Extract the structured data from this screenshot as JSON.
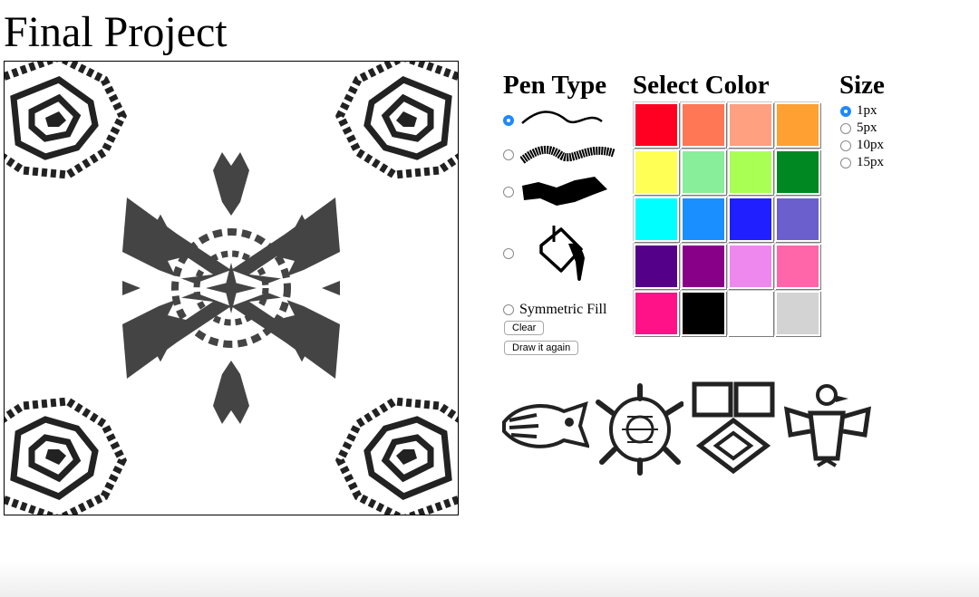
{
  "page": {
    "title": "Final Project"
  },
  "canvas": {
    "description_icon": "mandala-drawing"
  },
  "pen_type": {
    "title": "Pen Type",
    "options": [
      {
        "icon": "thin-wave-pen-icon",
        "selected": true
      },
      {
        "icon": "rough-pen-icon",
        "selected": false
      },
      {
        "icon": "thick-brush-pen-icon",
        "selected": false
      },
      {
        "icon": "paint-bucket-icon",
        "selected": false
      }
    ],
    "symmetric_fill_label": "Symmetric Fill",
    "clear_label": "Clear",
    "draw_again_label": "Draw it again"
  },
  "select_color": {
    "title": "Select Color",
    "colors": [
      "#ff0022",
      "#ff7755",
      "#ffa080",
      "#ffa033",
      "#ffff55",
      "#88ee99",
      "#aaff55",
      "#008822",
      "#00ffff",
      "#1a8fff",
      "#1f1fff",
      "#6a5fcc",
      "#550088",
      "#880088",
      "#ee88ee",
      "#ff66aa",
      "#ff1188",
      "#000000",
      "#ffffff",
      "#d3d3d3"
    ]
  },
  "size": {
    "title": "Size",
    "options": [
      {
        "label": "1px",
        "selected": true
      },
      {
        "label": "5px",
        "selected": false
      },
      {
        "label": "10px",
        "selected": false
      },
      {
        "label": "15px",
        "selected": false
      }
    ]
  },
  "stamps": [
    {
      "icon": "fish-stamp-icon"
    },
    {
      "icon": "turtle-stamp-icon"
    },
    {
      "icon": "tribal-pattern-stamp-icon"
    },
    {
      "icon": "bird-stamp-icon"
    }
  ]
}
